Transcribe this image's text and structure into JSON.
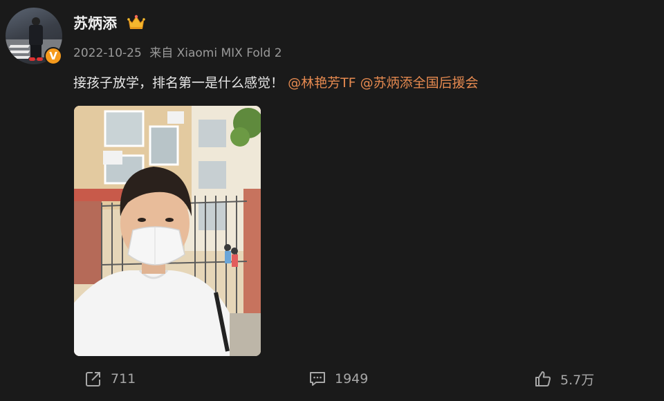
{
  "post": {
    "username": "苏炳添",
    "date": "2022-10-25",
    "source": "来自 Xiaomi MIX Fold 2",
    "text": "接孩子放学，排名第一是什么感觉！",
    "mentions": [
      "@林艳芳TF",
      "@苏炳添全国后援会"
    ],
    "verified_badge": "V",
    "icons": {
      "crown": "crown-icon",
      "repost": "share-icon",
      "comment": "comment-icon",
      "like": "thumbs-up-icon"
    },
    "colors": {
      "background": "#1a1a1a",
      "mention": "#e68a50",
      "verified": "#f59a1d"
    }
  },
  "actions": {
    "reposts": "711",
    "comments": "1949",
    "likes": "5.7万"
  }
}
